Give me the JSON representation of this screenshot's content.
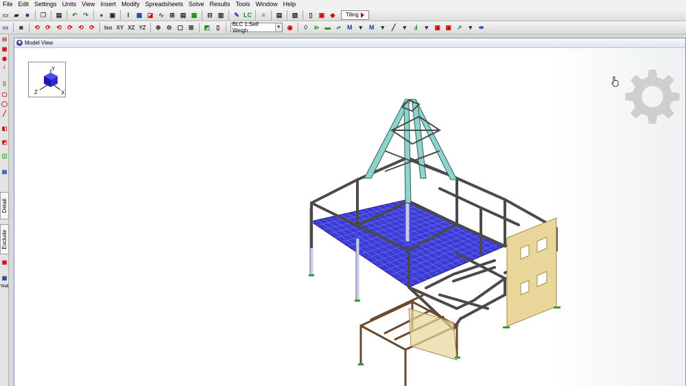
{
  "menubar": {
    "items": [
      "File",
      "Edit",
      "Settings",
      "Units",
      "View",
      "Insert",
      "Modify",
      "Spreadsheets",
      "Solve",
      "Results",
      "Tools",
      "Window",
      "Help"
    ]
  },
  "toolbar1": {
    "lc_label": "LC",
    "tiling_label": "Tiling"
  },
  "toolbar2": {
    "view_labels": [
      "Iso",
      "XY",
      "XZ",
      "YZ"
    ],
    "basic_load_case": "BLC 1:Self Weigh"
  },
  "left_toolbar": {
    "detail_label": "Detail",
    "exclude_label": "Exclude",
    "wall_label": "Wall"
  },
  "model_view": {
    "title": "Model View",
    "axes": {
      "y": "Y",
      "z": "Z",
      "x": "X"
    }
  },
  "colors": {
    "slab": "#3b3bd6",
    "braces": "#8fd3cc",
    "wall_panel": "#e8d69a",
    "steel": "#4a4a4a",
    "columns": "#c8cce8",
    "wood_frame": "#6a4a2a",
    "supports": "#2fa02f"
  },
  "icons": [
    "gear-watermark-icon",
    "hand-cursor-icon",
    "model-view-icon"
  ]
}
